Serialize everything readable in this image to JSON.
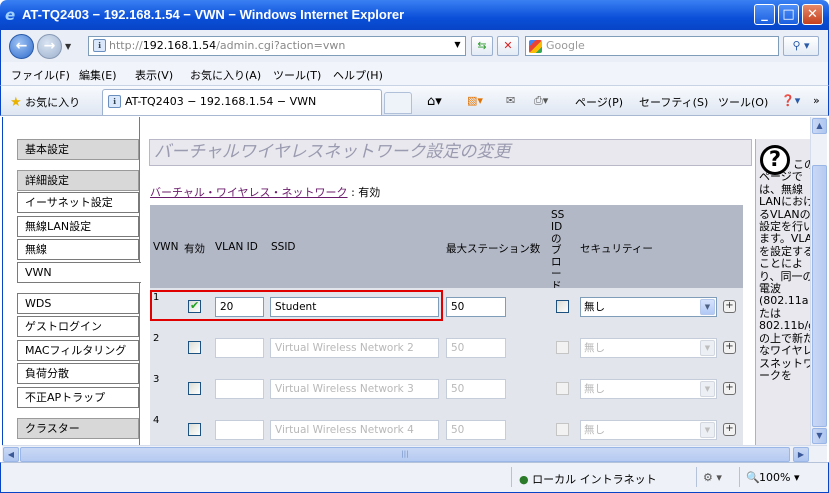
{
  "window": {
    "title": "AT-TQ2403 − 192.168.1.54 − VWN − Windows Internet Explorer",
    "minimize": "_",
    "maximize": "□",
    "close": "✕"
  },
  "address": {
    "url_prefix": "http://",
    "url_host": "192.168.1.54",
    "url_path": "/admin.cgi?action=vwn",
    "search_placeholder": "Google"
  },
  "menu": [
    "ファイル(F)",
    "編集(E)",
    "表示(V)",
    "お気に入り(A)",
    "ツール(T)",
    "ヘルプ(H)"
  ],
  "tabbar": {
    "favorites": "お気に入り",
    "tab_title": "AT-TQ2403 − 192.168.1.54 − VWN",
    "page_menu": "ページ(P)",
    "safety_menu": "セーフティ(S)",
    "tools_menu": "ツール(O)"
  },
  "nav": {
    "basic_settings": "基本設定",
    "advanced_settings": "詳細設定",
    "items": [
      "イーサネット設定",
      "無線LAN設定",
      "無線",
      "VWN",
      "WDS",
      "ゲストログイン",
      "MACフィルタリング",
      "負荷分散",
      "不正APトラップ"
    ],
    "cluster": "クラスター",
    "active": "VWN"
  },
  "main": {
    "heading": "バーチャルワイヤレスネットワーク設定の変更",
    "vwn_link": "バーチャル・ワイヤレス・ネットワーク",
    "vwn_status": ": 有効",
    "columns": {
      "vwn": "VWN",
      "enabled": "有効",
      "vlan": "VLAN ID",
      "ssid": "SSID",
      "max_stations": "最大ステーション数",
      "broadcast": "SSIDのブロードキャスト",
      "security": "セキュリティー"
    },
    "rows": [
      {
        "num": "1",
        "enabled": true,
        "vlan": "20",
        "ssid": "Student",
        "max": "50",
        "security": "無し",
        "disabled": false
      },
      {
        "num": "2",
        "enabled": false,
        "vlan": "",
        "ssid": "Virtual Wireless Network 2",
        "max": "50",
        "security": "無し",
        "disabled": true
      },
      {
        "num": "3",
        "enabled": false,
        "vlan": "",
        "ssid": "Virtual Wireless Network 3",
        "max": "50",
        "security": "無し",
        "disabled": true
      },
      {
        "num": "4",
        "enabled": false,
        "vlan": "",
        "ssid": "Virtual Wireless Network 4",
        "max": "50",
        "security": "無し",
        "disabled": true
      }
    ],
    "plus": "+"
  },
  "help": {
    "icon": "?",
    "text": "このページでは、無線LANにおけるVLANの設定を行います。VLANを設定することにより、同一の電波(802.11aまたは802.11b/g)の上で新たなワイヤレスネットワークを"
  },
  "status": {
    "zone": "ローカル イントラネット",
    "zoom": "100%"
  },
  "colors": {
    "titlebar": "#0a4fd8",
    "highlight_box": "#e00000",
    "table_header": "#b2b8c6",
    "table_body": "#e2e5ec"
  }
}
